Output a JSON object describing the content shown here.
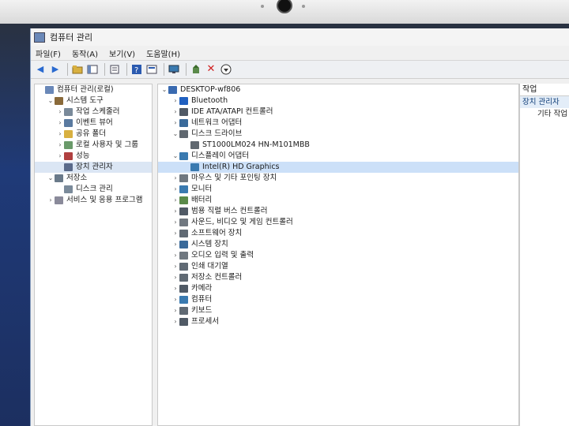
{
  "window": {
    "title": "컴퓨터 관리"
  },
  "menu": [
    "파일(F)",
    "동작(A)",
    "보기(V)",
    "도움말(H)"
  ],
  "toolbar": [
    "back-icon",
    "forward-icon",
    "folder-up-icon",
    "show-tree-icon",
    "export-icon",
    "help-icon",
    "properties-icon",
    "monitor-icon",
    "update-driver-icon",
    "uninstall-icon",
    "download-icon"
  ],
  "left_tree": [
    {
      "label": "컴퓨터 관리(로컬)",
      "indent": 0,
      "exp": "",
      "icon": "computer-management-icon",
      "color": "#6a88b8"
    },
    {
      "label": "시스템 도구",
      "indent": 1,
      "exp": "v",
      "icon": "tools-icon",
      "color": "#8a6a3a"
    },
    {
      "label": "작업 스케줄러",
      "indent": 2,
      "exp": ">",
      "icon": "scheduler-icon",
      "color": "#7a8a9a"
    },
    {
      "label": "이벤트 뷰어",
      "indent": 2,
      "exp": ">",
      "icon": "event-viewer-icon",
      "color": "#5a7aa0"
    },
    {
      "label": "공유 폴더",
      "indent": 2,
      "exp": ">",
      "icon": "shared-folder-icon",
      "color": "#d8b040"
    },
    {
      "label": "로컬 사용자 및 그룹",
      "indent": 2,
      "exp": ">",
      "icon": "users-icon",
      "color": "#6a9a6a"
    },
    {
      "label": "성능",
      "indent": 2,
      "exp": ">",
      "icon": "performance-icon",
      "color": "#b04040"
    },
    {
      "label": "장치 관리자",
      "indent": 2,
      "exp": "",
      "icon": "device-manager-icon",
      "color": "#5a6a8a",
      "selected": true
    },
    {
      "label": "저장소",
      "indent": 1,
      "exp": "v",
      "icon": "storage-icon",
      "color": "#6a7a8a"
    },
    {
      "label": "디스크 관리",
      "indent": 2,
      "exp": "",
      "icon": "disk-management-icon",
      "color": "#7a8a9a"
    },
    {
      "label": "서비스 및 응용 프로그램",
      "indent": 1,
      "exp": ">",
      "icon": "services-icon",
      "color": "#8a8a9a"
    }
  ],
  "device_tree": [
    {
      "label": "DESKTOP-wf806",
      "indent": 0,
      "exp": "v",
      "icon": "computer-icon",
      "color": "#3a6ab0"
    },
    {
      "label": "Bluetooth",
      "indent": 1,
      "exp": ">",
      "icon": "bluetooth-icon",
      "color": "#2060c0"
    },
    {
      "label": "IDE ATA/ATAPI 컨트롤러",
      "indent": 1,
      "exp": ">",
      "icon": "ide-controller-icon",
      "color": "#505a66"
    },
    {
      "label": "네트워크 어댑터",
      "indent": 1,
      "exp": ">",
      "icon": "network-adapter-icon",
      "color": "#3a6a9a"
    },
    {
      "label": "디스크 드라이브",
      "indent": 1,
      "exp": "v",
      "icon": "disk-drive-icon",
      "color": "#606870"
    },
    {
      "label": "ST1000LM024 HN-M101MBB",
      "indent": 2,
      "exp": "",
      "icon": "disk-icon",
      "color": "#606870"
    },
    {
      "label": "디스플레이 어댑터",
      "indent": 1,
      "exp": "v",
      "icon": "display-adapter-icon",
      "color": "#3a7ab0"
    },
    {
      "label": "Intel(R) HD Graphics",
      "indent": 2,
      "exp": "",
      "icon": "display-icon",
      "color": "#3a7ab0",
      "selected": true
    },
    {
      "label": "마우스 및 기타 포인팅 장치",
      "indent": 1,
      "exp": ">",
      "icon": "mouse-icon",
      "color": "#707880"
    },
    {
      "label": "모니터",
      "indent": 1,
      "exp": ">",
      "icon": "monitor-icon",
      "color": "#3a7ab0"
    },
    {
      "label": "배터리",
      "indent": 1,
      "exp": ">",
      "icon": "battery-icon",
      "color": "#5a8a4a"
    },
    {
      "label": "범용 직렬 버스 컨트롤러",
      "indent": 1,
      "exp": ">",
      "icon": "usb-icon",
      "color": "#505a66"
    },
    {
      "label": "사운드, 비디오 및 게임 컨트롤러",
      "indent": 1,
      "exp": ">",
      "icon": "sound-icon",
      "color": "#707880"
    },
    {
      "label": "소프트웨어 장치",
      "indent": 1,
      "exp": ">",
      "icon": "software-device-icon",
      "color": "#606a74"
    },
    {
      "label": "시스템 장치",
      "indent": 1,
      "exp": ">",
      "icon": "system-device-icon",
      "color": "#3a6a9a"
    },
    {
      "label": "오디오 입력 및 출력",
      "indent": 1,
      "exp": ">",
      "icon": "audio-icon",
      "color": "#707880"
    },
    {
      "label": "인쇄 대기열",
      "indent": 1,
      "exp": ">",
      "icon": "printer-icon",
      "color": "#606a74"
    },
    {
      "label": "저장소 컨트롤러",
      "indent": 1,
      "exp": ">",
      "icon": "storage-controller-icon",
      "color": "#606a74"
    },
    {
      "label": "카메라",
      "indent": 1,
      "exp": ">",
      "icon": "camera-icon",
      "color": "#505a66"
    },
    {
      "label": "컴퓨터",
      "indent": 1,
      "exp": ">",
      "icon": "computer-icon",
      "color": "#3a7ab0"
    },
    {
      "label": "키보드",
      "indent": 1,
      "exp": ">",
      "icon": "keyboard-icon",
      "color": "#606a74"
    },
    {
      "label": "프로세서",
      "indent": 1,
      "exp": ">",
      "icon": "processor-icon",
      "color": "#505a66"
    }
  ],
  "actions": {
    "header": "작업",
    "selected": "장치 관리자",
    "item": "기타 작업"
  }
}
